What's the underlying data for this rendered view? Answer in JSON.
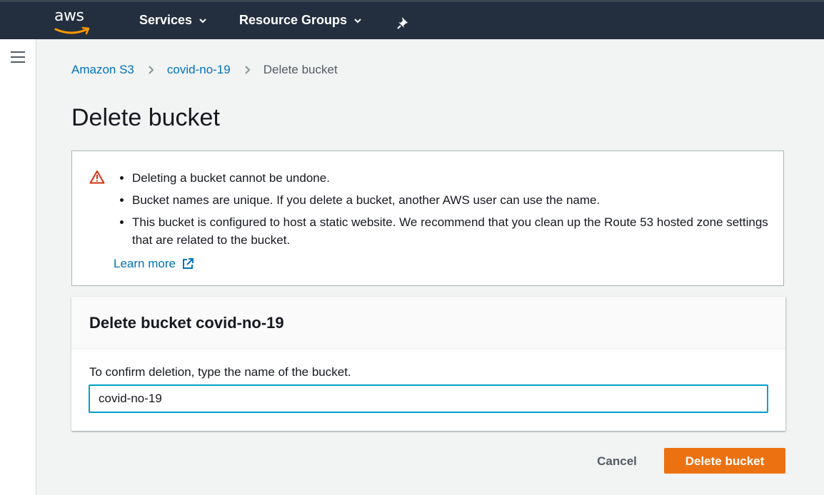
{
  "topbar": {
    "logo_text": "aws",
    "services_label": "Services",
    "resource_groups_label": "Resource Groups",
    "pin_icon": "pin-icon"
  },
  "breadcrumb": {
    "items": [
      "Amazon S3",
      "covid-no-19"
    ],
    "current": "Delete bucket"
  },
  "page": {
    "title": "Delete bucket"
  },
  "alert": {
    "icon": "warning-icon",
    "bullets": [
      "Deleting a bucket cannot be undone.",
      "Bucket names are unique. If you delete a bucket, another AWS user can use the name.",
      "This bucket is configured to host a static website. We recommend that you clean up the Route 53 hosted zone settings that are related to the bucket."
    ],
    "learn_more": "Learn more"
  },
  "panel": {
    "title": "Delete bucket covid-no-19",
    "confirm_label": "To confirm deletion, type the name of the bucket.",
    "input_value": "covid-no-19"
  },
  "actions": {
    "cancel": "Cancel",
    "delete": "Delete bucket"
  },
  "colors": {
    "topbar": "#232f3e",
    "link": "#0073bb",
    "primary_button": "#ec7211",
    "input_focus": "#00a1c9",
    "warning": "#d13212"
  }
}
